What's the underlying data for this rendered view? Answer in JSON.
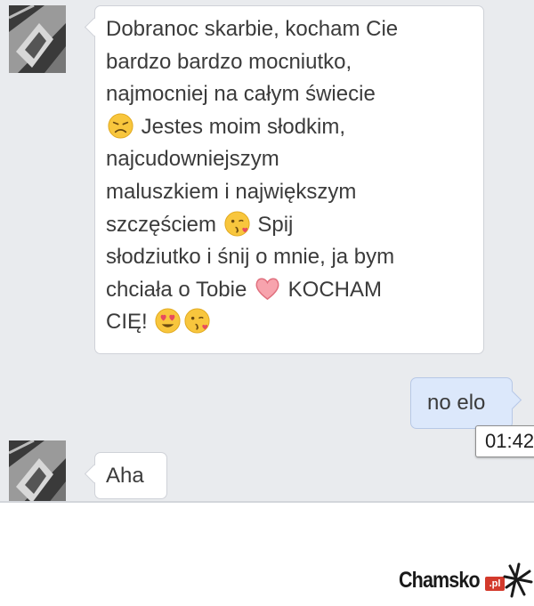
{
  "conversation": {
    "messages": [
      {
        "sender": "other",
        "segments": [
          {
            "text": "Dobranoc skarbie, kocham Cie\nbardzo bardzo mocniutko,\nnajmocniej na całym świecie\n"
          },
          {
            "emoji": "disappointed-face-icon"
          },
          {
            "text": " Jestes moim słodkim,\nnajcudowniejszym\nmaluszkiem i największym\nszczęściem "
          },
          {
            "emoji": "kissing-face-icon"
          },
          {
            "text": " Spij\nsłodziutko i śnij o mnie, ja bym\nchciała o Tobie "
          },
          {
            "emoji": "heart-icon"
          },
          {
            "text": " KOCHAM\nCIĘ! "
          },
          {
            "emoji": "heart-eyes-face-icon"
          },
          {
            "emoji": "kissing-face-icon"
          }
        ]
      },
      {
        "sender": "me",
        "text": "no elo"
      },
      {
        "sender": "other",
        "text": "Aha"
      }
    ],
    "timestamp_tooltip": "01:42"
  },
  "watermark": {
    "brand": "Chamsko",
    "tld": ".pl"
  },
  "colors": {
    "chat_background": "#e9ebee",
    "incoming_bubble": "#ffffff",
    "outgoing_bubble": "#dce8fb",
    "text": "#3b3b3b"
  }
}
